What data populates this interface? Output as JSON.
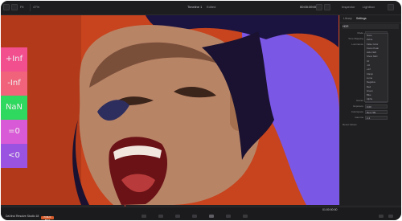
{
  "window": {
    "title": "Timeline 1",
    "edited": "Edited"
  },
  "toolbar": {
    "left_label": "Fit",
    "zoom": "47%",
    "timecode": "00:00:39:00",
    "right_items": [
      "Inspector",
      "Lightbox"
    ]
  },
  "legend": {
    "items": [
      {
        "label": "+Inf",
        "color": "#f24f8f"
      },
      {
        "label": "-Inf",
        "color": "#f0637a"
      },
      {
        "label": "NaN",
        "color": "#2fd85e"
      },
      {
        "label": "=0",
        "color": "#d95ad6"
      },
      {
        "label": "<0",
        "color": "#9a52e0"
      }
    ]
  },
  "panel": {
    "tabs": [
      "Library",
      "Settings"
    ],
    "section_title": "HDR",
    "rows": [
      {
        "label": "Mode",
        "value": "Off"
      },
      {
        "label": "Tone Mapping",
        "value": "Simple"
      },
      {
        "label": "Luminance",
        "value": "100"
      },
      {
        "label": "Gamut",
        "value": "Rec.709"
      },
      {
        "label": "Exposure",
        "value": "0.00"
      }
    ],
    "dropdown_items": [
      "None",
      "Zebra",
      "False Color",
      "Focus Peak",
      "Hide NaN",
      "Show NaN",
      "Inf",
      "-Inf",
      "+Inf",
      "Clamp",
      "Luma",
      "Negative",
      "Red",
      "Green",
      "Blue",
      "Alpha"
    ],
    "lower_rows": [
      {
        "label": "Colorspace",
        "value": "Rec.709"
      },
      {
        "label": "Gamma",
        "value": "2.4"
      }
    ],
    "footer_label": "Reset Values"
  },
  "bottom": {
    "app_name": "DaVinci Resolve Studio 18",
    "badge": "PUBLIC BETA",
    "timecode": "01:00:00:00"
  }
}
